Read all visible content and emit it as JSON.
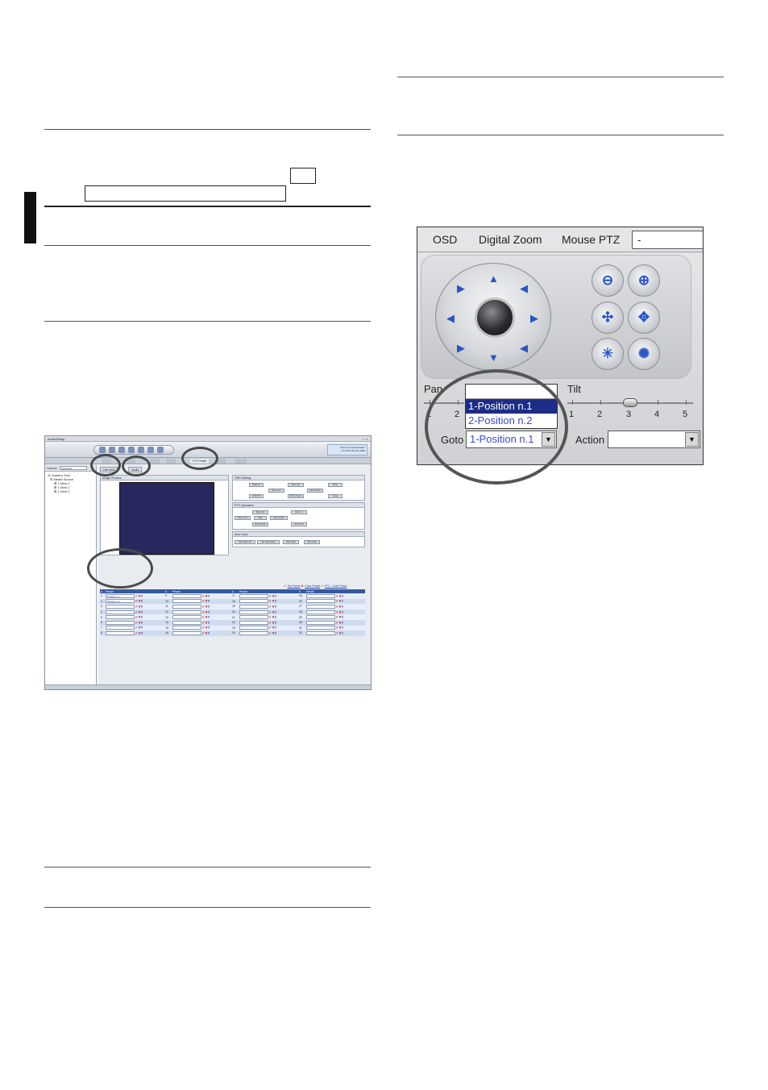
{
  "boxes": {
    "small_box": "",
    "long_box": ""
  },
  "screenshot": {
    "window_title": "ActiveSetup",
    "admin_line1": "Admin as Administrator",
    "admin_line2": "17:11:55 Oct 26, 2006",
    "tabs": [
      "PTZ Preset"
    ],
    "camera_label": "Camera:",
    "camera_value": "Camera 2",
    "tree": [
      "Camera Tree",
      "Media Source",
      "1.View 1",
      "1.View 1",
      "1.View 2"
    ],
    "subtabs": [
      "Live View",
      "Audio"
    ],
    "image_preview_title": "Image Preview",
    "osd_title": "OSD Setting",
    "osd_buttons": [
      "OSD On",
      "Move Left",
      "OSD Off",
      "Move Up",
      "Move Down",
      "Move Right",
      "Enter",
      "Leave"
    ],
    "ptz_title": "PTZ Operation",
    "ptz_buttons": [
      "Move Up",
      "Zoom In",
      "Move Left",
      "Stop",
      "Move Right",
      "Move Down",
      "Zoom Out"
    ],
    "autoscan_title": "Auto Scan",
    "autoscan_buttons": [
      "Set Scan Left",
      "Set Scan Right",
      "Start Scan",
      "Stop Scan"
    ],
    "legend": {
      "set": "Set Preset",
      "clear": "Clear Preset",
      "goto": "PTZ - Goto Preset"
    },
    "table_headers": [
      "#",
      "Preset",
      "#",
      "Preset",
      "#",
      "Preset",
      "#",
      "Preset"
    ],
    "table_rows": [
      {
        "n": [
          "1",
          "9",
          "17",
          "25"
        ],
        "v": [
          "Position n.1",
          "",
          "",
          ""
        ]
      },
      {
        "n": [
          "2",
          "10",
          "18",
          "26"
        ],
        "v": [
          "Position n.2",
          "",
          "",
          ""
        ]
      },
      {
        "n": [
          "3",
          "11",
          "19",
          "27"
        ],
        "v": [
          "",
          "",
          "",
          ""
        ]
      },
      {
        "n": [
          "4",
          "12",
          "20",
          "28"
        ],
        "v": [
          "",
          "",
          "",
          ""
        ]
      },
      {
        "n": [
          "5",
          "13",
          "21",
          "29"
        ],
        "v": [
          "",
          "",
          "",
          ""
        ]
      },
      {
        "n": [
          "6",
          "14",
          "22",
          "30"
        ],
        "v": [
          "",
          "",
          "",
          ""
        ]
      },
      {
        "n": [
          "7",
          "15",
          "23",
          "31"
        ],
        "v": [
          "",
          "",
          "",
          ""
        ]
      },
      {
        "n": [
          "8",
          "16",
          "24",
          "32"
        ],
        "v": [
          "",
          "",
          "",
          ""
        ]
      }
    ]
  },
  "ptz": {
    "menu": [
      "OSD",
      "Digital Zoom",
      "Mouse PTZ"
    ],
    "mouse_ptz_value": "-",
    "pan_label": "Pan",
    "tilt_label": "Tilt",
    "pan_scale": [
      "1",
      "2"
    ],
    "tilt_scale": [
      "1",
      "2",
      "3",
      "4",
      "5"
    ],
    "dropdown_options": [
      "1-Position n.1",
      "2-Position n.2"
    ],
    "goto_label": "Goto",
    "goto_value": "1-Position n.1",
    "action_label": "Action",
    "action_value": ""
  }
}
